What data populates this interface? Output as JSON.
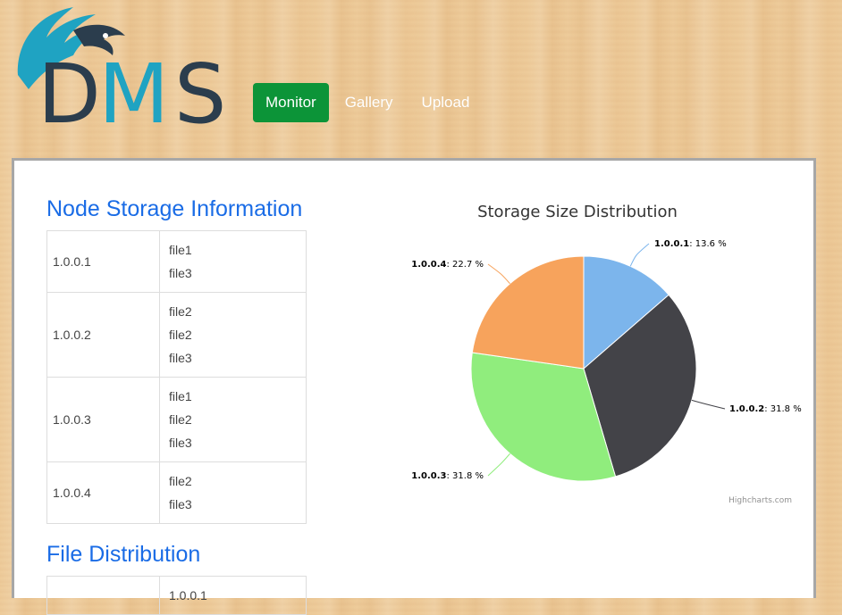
{
  "brand": {
    "logo_text": "DMS"
  },
  "nav": {
    "items": [
      {
        "label": "Monitor",
        "active": true
      },
      {
        "label": "Gallery",
        "active": false
      },
      {
        "label": "Upload",
        "active": false
      }
    ]
  },
  "node_storage": {
    "title": "Node Storage Information",
    "rows": [
      {
        "node": "1.0.0.1",
        "files": [
          "file1",
          "file3"
        ]
      },
      {
        "node": "1.0.0.2",
        "files": [
          "file2",
          "file2",
          "file3"
        ]
      },
      {
        "node": "1.0.0.3",
        "files": [
          "file1",
          "file2",
          "file3"
        ]
      },
      {
        "node": "1.0.0.4",
        "files": [
          "file2",
          "file3"
        ]
      }
    ]
  },
  "file_distribution": {
    "title": "File Distribution",
    "first_cell": "1.0.0.1"
  },
  "chart_data": {
    "type": "pie",
    "title": "Storage Size Distribution",
    "slices": [
      {
        "name": "1.0.0.1",
        "value": 13.6,
        "label": "13.6 %",
        "color": "#7cb5ec"
      },
      {
        "name": "1.0.0.2",
        "value": 31.8,
        "label": "31.8 %",
        "color": "#434348"
      },
      {
        "name": "1.0.0.3",
        "value": 31.8,
        "label": "31.8 %",
        "color": "#90ed7d"
      },
      {
        "name": "1.0.0.4",
        "value": 22.7,
        "label": "22.7 %",
        "color": "#f7a35c"
      }
    ],
    "credit": "Highcharts.com"
  }
}
